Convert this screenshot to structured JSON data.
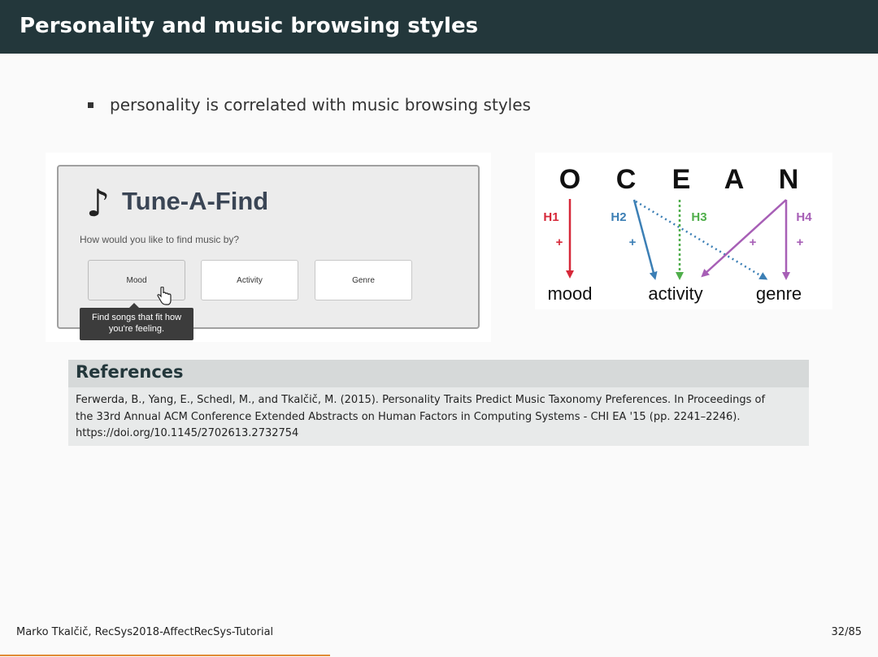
{
  "slide": {
    "title": "Personality and music browsing styles",
    "bullet": "personality is correlated with music browsing styles"
  },
  "tune_a_find": {
    "logo_text": "Tune-A-Find",
    "question": "How would you like to find music by?",
    "buttons": [
      "Mood",
      "Activity",
      "Genre"
    ],
    "tooltip_line1": "Find songs that fit how",
    "tooltip_line2": "you're feeling."
  },
  "ocean_diagram": {
    "traits": [
      "O",
      "C",
      "E",
      "A",
      "N"
    ],
    "hypotheses": [
      "H1",
      "H2",
      "H3",
      "H4"
    ],
    "signs": [
      "+",
      "+",
      "+",
      "+"
    ],
    "targets": [
      "mood",
      "activity",
      "genre"
    ],
    "colors": {
      "H1": "#d62839",
      "H2": "#3c7fb5",
      "H3": "#4fae4a",
      "H4": "#a75fb6"
    }
  },
  "references": {
    "heading": "References",
    "line1": "Ferwerda, B., Yang, E., Schedl, M., and Tkalčič, M. (2015). Personality Traits Predict Music Taxonomy Preferences. In Proceedings of",
    "line2": "the 33rd Annual ACM Conference Extended Abstracts on Human Factors in Computing Systems - CHI EA '15 (pp. 2241–2246).",
    "line3": "https://doi.org/10.1145/2702613.2732754"
  },
  "footer": {
    "author": "Marko Tkalčič, RecSys2018-AffectRecSys-Tutorial",
    "page": "32/85"
  }
}
